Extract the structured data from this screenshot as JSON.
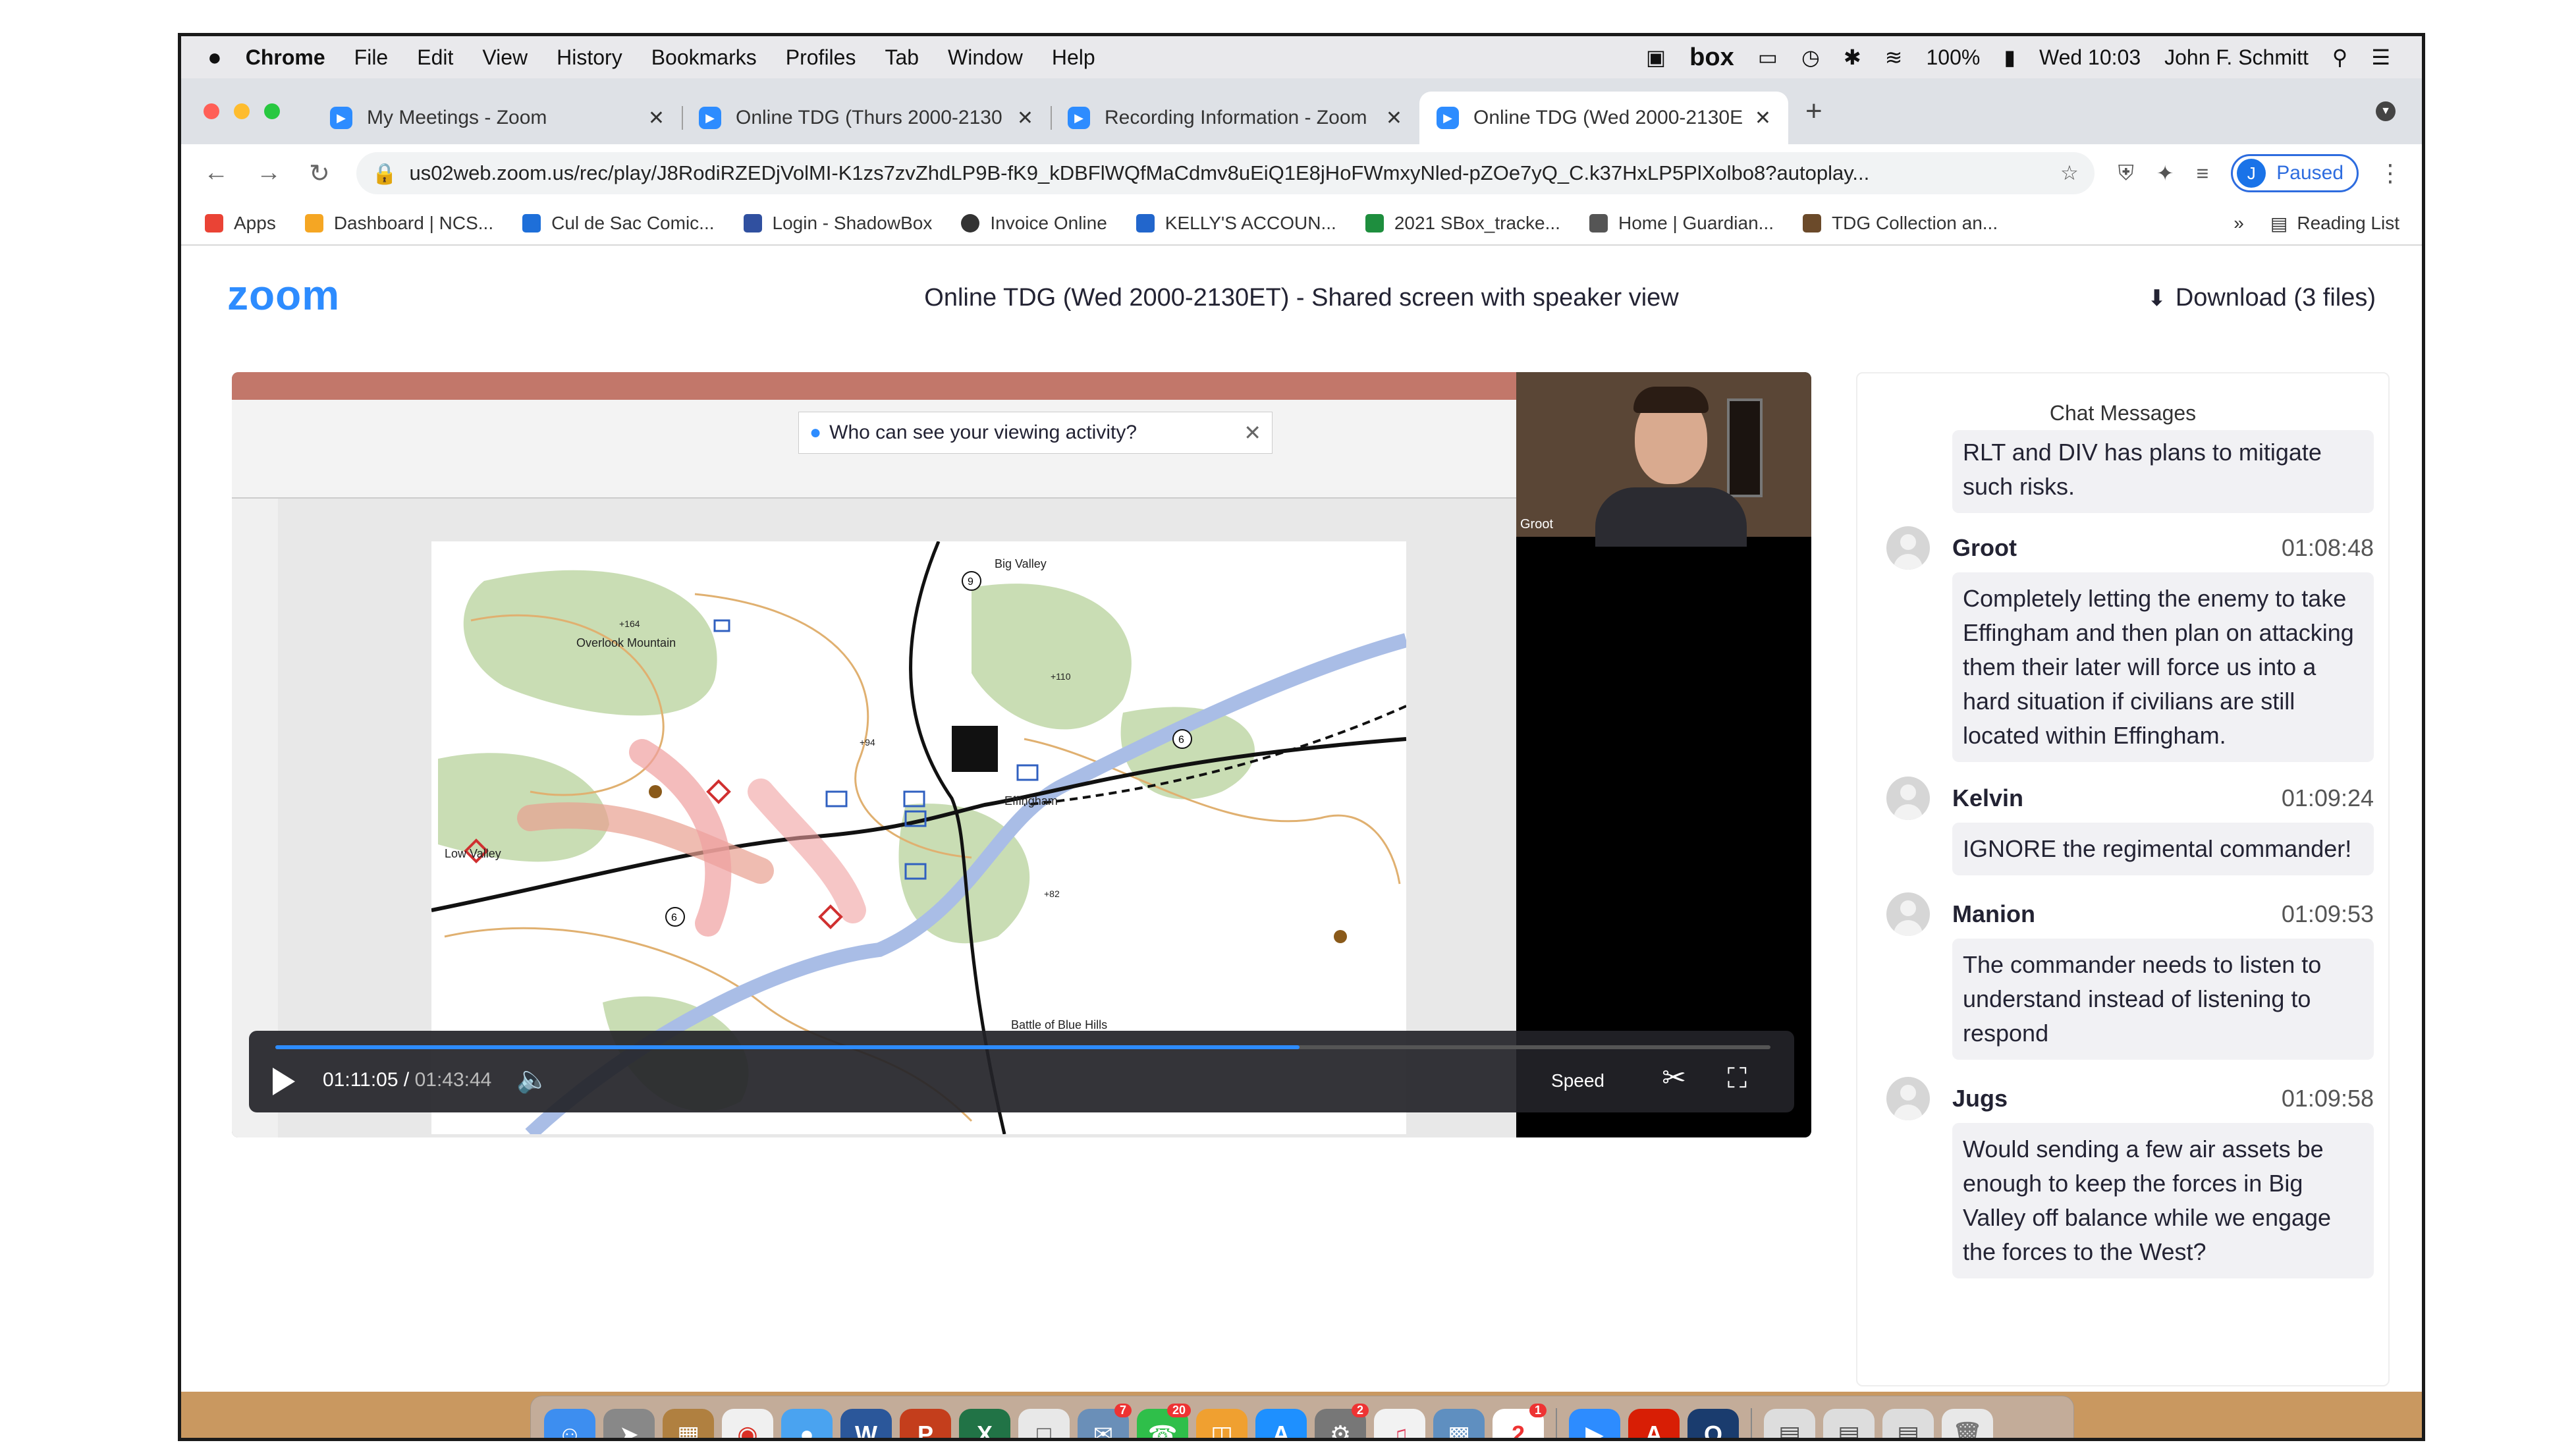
{
  "menubar": {
    "apple": "",
    "app": "Chrome",
    "items": [
      "File",
      "Edit",
      "View",
      "History",
      "Bookmarks",
      "Profiles",
      "Tab",
      "Window",
      "Help"
    ],
    "box": "box",
    "battery": "100%",
    "datetime": "Wed 10:03",
    "user": "John F. Schmitt"
  },
  "tabs": [
    {
      "title": "My Meetings - Zoom"
    },
    {
      "title": "Online TDG (Thurs 2000-2130"
    },
    {
      "title": "Recording Information - Zoom"
    },
    {
      "title": "Online TDG (Wed 2000-2130E"
    }
  ],
  "toolbar": {
    "url": "us02web.zoom.us/rec/play/J8RodiRZEDjVolMI-K1zs7zvZhdLP9B-fK9_kDBFlWQfMaCdmv8uEiQ1E8jHoFWmxyNled-pZOe7yQ_C.k37HxLP5PlXolbo8?autoplay...",
    "profile_initial": "J",
    "profile_status": "Paused"
  },
  "bookmarks": {
    "items": [
      "Apps",
      "Dashboard | NCS...",
      "Cul de Sac Comic...",
      "Login - ShadowBox",
      "Invoice Online",
      "KELLY'S ACCOUN...",
      "2021 SBox_tracke...",
      "Home | Guardian...",
      "TDG Collection an..."
    ],
    "more": "»",
    "reading_list": "Reading List"
  },
  "page": {
    "logo": "zoom",
    "title": "Online TDG (Wed 2000-2130ET) - Shared screen with speaker view",
    "download": "Download (3 files)"
  },
  "video": {
    "toast": "Who can see your viewing activity?",
    "speaker_name": "Groot",
    "current_time": "01:11:05",
    "separator": "/",
    "duration": "01:43:44",
    "progress": 0.685,
    "speed_label": "Speed",
    "map": {
      "labels": [
        "Big Valley",
        "Overlook Mountain",
        "+164",
        "+110",
        "+94",
        "Effingham",
        "Low Valley",
        "+82",
        "Battle of Blue Hills"
      ],
      "route_numbers": [
        "9",
        "6",
        "6"
      ]
    }
  },
  "chat": {
    "title": "Chat Messages",
    "continuation": "RLT and DIV has plans to mitigate such risks.",
    "messages": [
      {
        "sender": "Groot",
        "time": "01:08:48",
        "text": "Completely letting the enemy to take Effingham and then plan on attacking them their later will force us into a hard situation if civilians are still located within Effingham."
      },
      {
        "sender": "Kelvin",
        "time": "01:09:24",
        "text": "IGNORE the regimental commander!"
      },
      {
        "sender": "Manion",
        "time": "01:09:53",
        "text": "The commander needs to listen to understand instead of listening to respond"
      },
      {
        "sender": "Jugs",
        "time": "01:09:58",
        "text": "Would sending a few air assets be enough to keep the forces in Big Valley off balance while we engage the forces to the West?"
      }
    ]
  },
  "dock": {
    "badges": [
      "7",
      "20",
      "2",
      "2",
      "1"
    ]
  }
}
